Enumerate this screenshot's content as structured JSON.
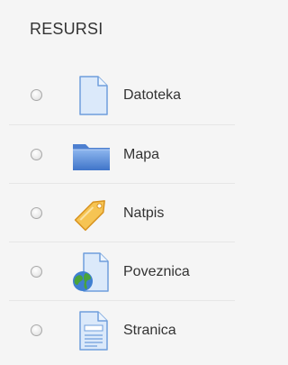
{
  "section": {
    "title": "RESURSI"
  },
  "resources": [
    {
      "label": "Datoteka",
      "icon": "file-icon"
    },
    {
      "label": "Mapa",
      "icon": "folder-icon"
    },
    {
      "label": "Natpis",
      "icon": "label-tag-icon"
    },
    {
      "label": "Poveznica",
      "icon": "url-globe-icon"
    },
    {
      "label": "Stranica",
      "icon": "page-icon"
    }
  ],
  "colors": {
    "background": "#f5f5f5",
    "text": "#333333",
    "icon_blue": "#5b8fd9",
    "tag_orange": "#f2b233",
    "globe_green": "#4a9a3a"
  }
}
